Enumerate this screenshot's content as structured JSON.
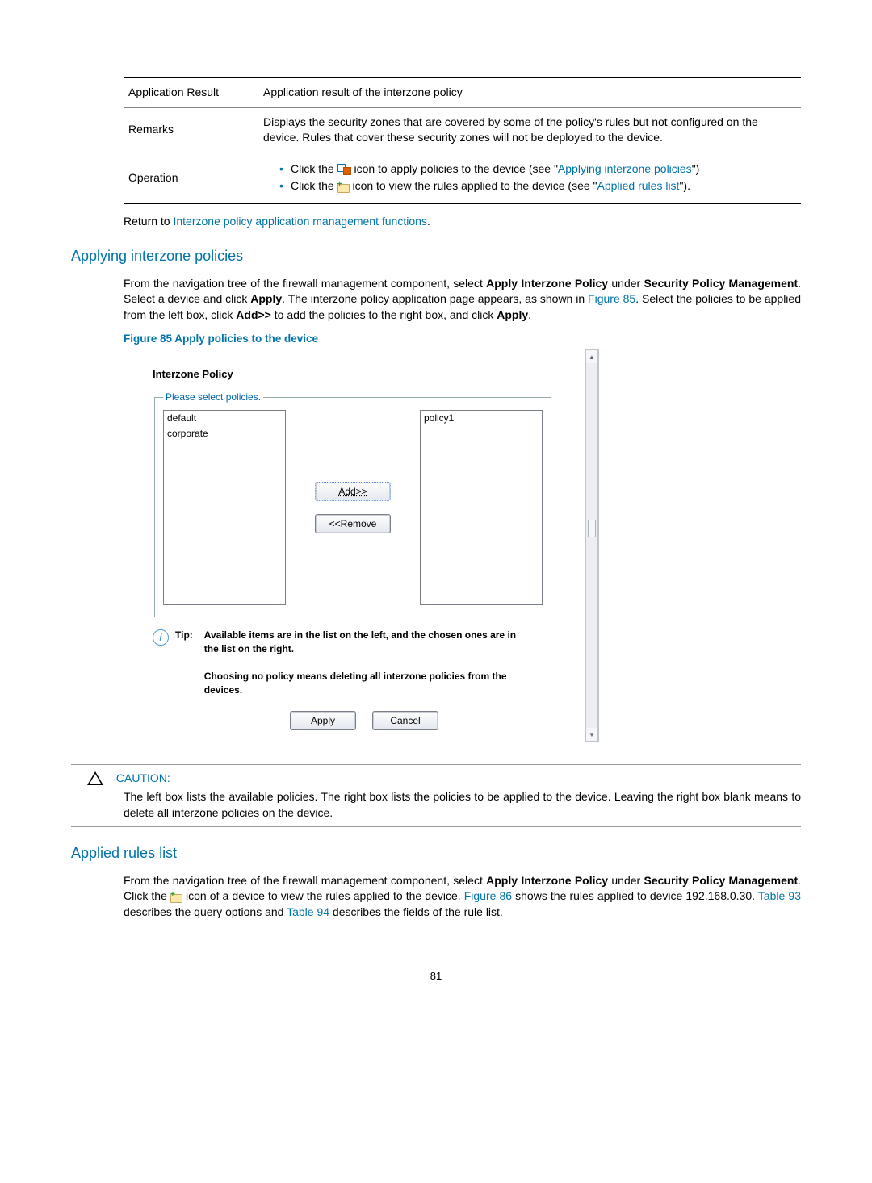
{
  "table": {
    "rows": [
      {
        "field": "Application Result",
        "desc": "Application result of the interzone policy"
      },
      {
        "field": "Remarks",
        "desc": "Displays the security zones that are covered by some of the policy's rules but not configured on the device. Rules that cover these security zones will not be deployed to the device."
      },
      {
        "field": "Operation",
        "bullets": [
          {
            "prefix": "Click the ",
            "icon": "apply",
            "mid": " icon to apply policies to the device (see \"",
            "link": "Applying interzone policies",
            "suffix": "\")"
          },
          {
            "prefix": "Click the ",
            "icon": "rules",
            "mid": " icon to view the rules applied to the device (see \"",
            "link": "Applied rules list",
            "suffix": "\")."
          }
        ]
      }
    ]
  },
  "return_prefix": "Return to ",
  "return_link": "Interzone policy application management functions",
  "return_suffix": ".",
  "sect1": {
    "heading": "Applying interzone policies",
    "p1_a": "From the navigation tree of the firewall management component, select ",
    "p1_b": "Apply Interzone Policy",
    "p1_c": " under ",
    "p1_d": "Security Policy Management",
    "p1_e": ". Select a device and click ",
    "p1_f": "Apply",
    "p1_g": ". The interzone policy application page appears, as shown in ",
    "p1_link": "Figure 85",
    "p1_h": ". Select the policies to be applied from the left box, click ",
    "p1_i": "Add>>",
    "p1_j": " to add the policies to the right box, and click ",
    "p1_k": "Apply",
    "p1_l": "."
  },
  "figure": {
    "caption": "Figure 85 Apply policies to the device",
    "title": "Interzone Policy",
    "legend": "Please select policies.",
    "left_items": [
      "default",
      "corporate"
    ],
    "right_items": [
      "policy1"
    ],
    "add_btn": "Add>>",
    "remove_btn": "<<Remove",
    "tip_label": "Tip:",
    "tip_line1": "Available items are in the list on the left, and the chosen ones are in the list on the right.",
    "tip_line2": "Choosing no policy means deleting all interzone policies from the devices.",
    "apply_btn": "Apply",
    "cancel_btn": "Cancel"
  },
  "caution": {
    "label": "CAUTION:",
    "body": "The left box lists the available policies. The right box lists the policies to be applied to the device. Leaving the right box blank means to delete all interzone policies on the device."
  },
  "sect2": {
    "heading": "Applied rules list",
    "a": "From the navigation tree of the firewall management component, select ",
    "b": "Apply Interzone Policy",
    "c": " under ",
    "d": "Security Policy Management",
    "e": ". Click the ",
    "f": " icon of a device to view the rules applied to the device. ",
    "link1": "Figure 86",
    "g": " shows the rules applied to device 192.168.0.30. ",
    "link2": "Table 93",
    "h": " describes the query options and ",
    "link3": "Table 94",
    "i": " describes the fields of the rule list."
  },
  "page_number": "81"
}
